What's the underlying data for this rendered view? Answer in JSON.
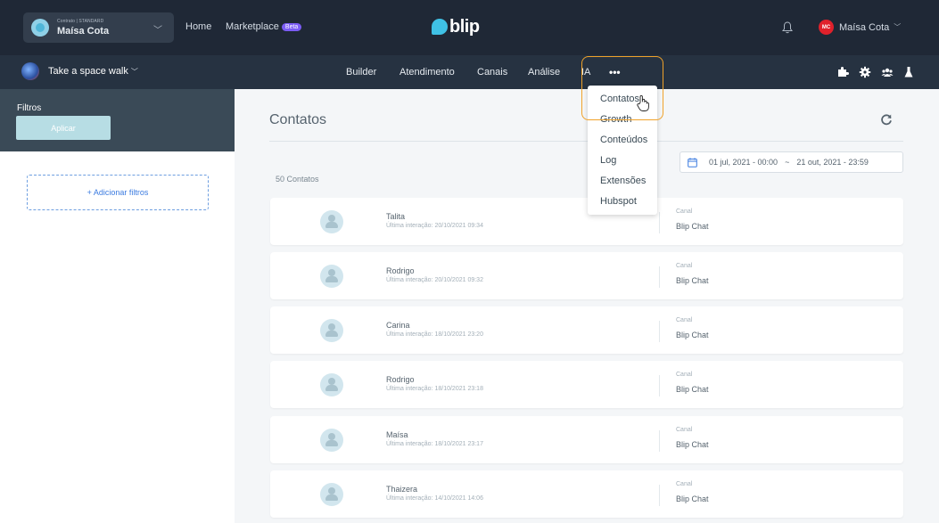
{
  "topbar": {
    "contract_small": "Contrato | STANDARD",
    "contract_name": "Maísa Cota",
    "nav_home": "Home",
    "nav_marketplace": "Marketplace",
    "beta_badge": "Beta",
    "logo": "blip",
    "user_initials": "MC",
    "user_name": "Maísa Cota"
  },
  "subbar": {
    "bot_name": "Take a space walk",
    "nav": [
      "Builder",
      "Atendimento",
      "Canais",
      "Análise",
      "IA"
    ],
    "more": "•••"
  },
  "sidebar": {
    "title": "Filtros",
    "apply_label": "Aplicar",
    "add_filters_label": "+ Adicionar filtros"
  },
  "main": {
    "title": "Contatos",
    "count": "50 Contatos",
    "date_from": "01 jul, 2021 - 00:00",
    "date_sep": "~",
    "date_to": "21 out, 2021 - 23:59",
    "channel_label": "Canal",
    "contacts": [
      {
        "name": "Talita",
        "last": "Última interação: 20/10/2021 09:34",
        "channel": "Blip Chat"
      },
      {
        "name": "Rodrigo",
        "last": "Última interação: 20/10/2021 09:32",
        "channel": "Blip Chat"
      },
      {
        "name": "Carina",
        "last": "Última interação: 18/10/2021 23:20",
        "channel": "Blip Chat"
      },
      {
        "name": "Rodrigo",
        "last": "Última interação: 18/10/2021 23:18",
        "channel": "Blip Chat"
      },
      {
        "name": "Maísa",
        "last": "Última interação: 18/10/2021 23:17",
        "channel": "Blip Chat"
      },
      {
        "name": "Thaizera",
        "last": "Última interação: 14/10/2021 14:06",
        "channel": "Blip Chat"
      }
    ]
  },
  "dropdown": {
    "items": [
      "Contatos",
      "Growth",
      "Conteúdos",
      "Log",
      "Extensões",
      "Hubspot"
    ]
  },
  "colors": {
    "topbar": "#1f2836",
    "subbar": "#263241",
    "accent": "#3fc1e5",
    "highlight": "#f0a22a"
  }
}
